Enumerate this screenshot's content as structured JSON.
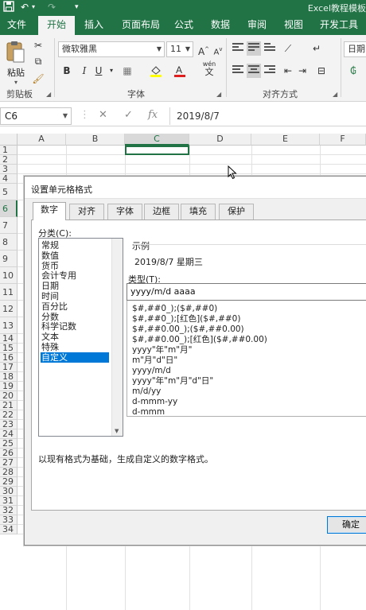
{
  "app": {
    "title": "Excel教程模板"
  },
  "quick_access": {
    "save_icon": "save-icon",
    "undo": "↶",
    "redo": "↷",
    "customize": "▾"
  },
  "ribbon_tabs": [
    {
      "label": "文件"
    },
    {
      "label": "开始"
    },
    {
      "label": "插入"
    },
    {
      "label": "页面布局"
    },
    {
      "label": "公式"
    },
    {
      "label": "数据"
    },
    {
      "label": "审阅"
    },
    {
      "label": "视图"
    },
    {
      "label": "开发工具"
    }
  ],
  "active_tab": "开始",
  "ribbon": {
    "clipboard": {
      "paste_label": "粘贴",
      "group_label": "剪贴板"
    },
    "font": {
      "name": "微软雅黑",
      "size": "11",
      "group_label": "字体",
      "grow": "A",
      "shrink": "A",
      "bold": "B",
      "italic": "I",
      "underline": "U",
      "wen": "wén",
      "wen_char": "文"
    },
    "alignment": {
      "group_label": "对齐方式"
    },
    "number": {
      "format": "日期"
    }
  },
  "formula_bar": {
    "name_box": "C6",
    "cancel": "✕",
    "enter": "✓",
    "fx": "fx",
    "value": "2019/8/7"
  },
  "columns": [
    "A",
    "B",
    "C",
    "D",
    "E",
    "F"
  ],
  "selected_column": "C",
  "rows": [
    "1",
    "2",
    "3",
    "4",
    "5",
    "6",
    "7",
    "8",
    "9",
    "10",
    "11",
    "12",
    "13",
    "14",
    "15",
    "16",
    "17",
    "18",
    "19",
    "20",
    "21",
    "22",
    "23",
    "24",
    "25",
    "26",
    "27",
    "28",
    "29",
    "30",
    "31",
    "32",
    "33",
    "34"
  ],
  "dialog": {
    "title": "设置单元格格式",
    "tabs": [
      "数字",
      "对齐",
      "字体",
      "边框",
      "填充",
      "保护"
    ],
    "active_tab": "数字",
    "category_label": "分类(C):",
    "categories": [
      "常规",
      "数值",
      "货币",
      "会计专用",
      "日期",
      "时间",
      "百分比",
      "分数",
      "科学记数",
      "文本",
      "特殊",
      "自定义"
    ],
    "selected_category": "自定义",
    "sample_label": "示例",
    "sample_value": "2019/8/7 星期三",
    "type_label": "类型(T):",
    "type_value": "yyyy/m/d aaaa",
    "formats": [
      "$#,##0_);($#,##0)",
      "$#,##0_);[红色]($#,##0)",
      "$#,##0.00_);($#,##0.00)",
      "$#,##0.00_);[红色]($#,##0.00)",
      "yyyy\"年\"m\"月\"",
      "m\"月\"d\"日\"",
      "yyyy/m/d",
      "yyyy\"年\"m\"月\"d\"日\"",
      "m/d/yy",
      "d-mmm-yy",
      "d-mmm"
    ],
    "description": "以现有格式为基础，生成自定义的数字格式。",
    "ok_label": "确定"
  }
}
